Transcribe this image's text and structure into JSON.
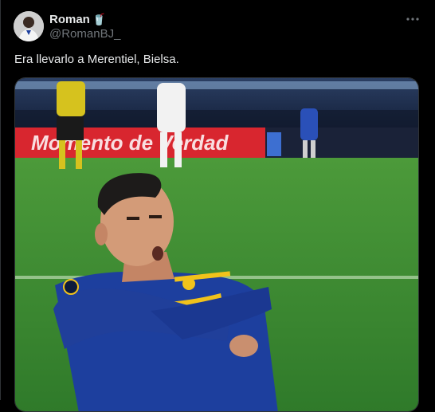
{
  "tweet": {
    "author": {
      "display_name": "Roman",
      "name_emoji": "🥤",
      "handle": "@RomanBJ_"
    },
    "text": "Era llevarlo a Merentiel, Bielsa.",
    "more_icon": "more-horizontal-icon"
  },
  "media": {
    "ad_board_text": "Momento de Verdad",
    "colors": {
      "pitch": "#3f8f2f",
      "ad_board": "#d8262f",
      "jersey_blue": "#1d3f9e",
      "jersey_gold": "#f1c21b"
    }
  }
}
